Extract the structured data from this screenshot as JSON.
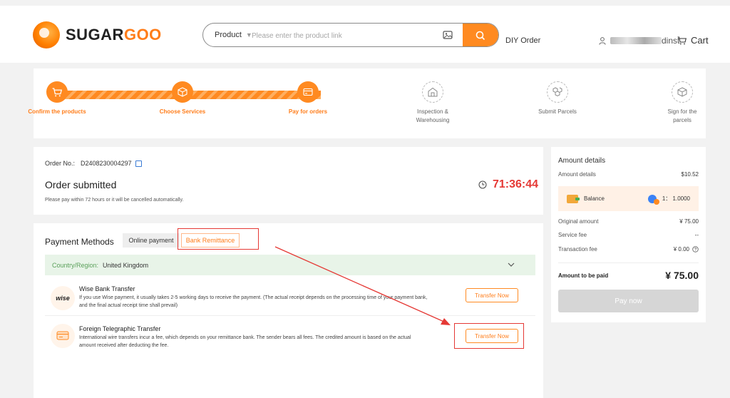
{
  "brand": {
    "name_part1": "SUGAR",
    "name_part2": "GOO"
  },
  "header": {
    "search_type": "Product",
    "search_placeholder": "Please enter the product link",
    "diy_order": "DIY Order",
    "user_suffix": "dinst",
    "cart": "Cart"
  },
  "steps": [
    {
      "label": "Confirm the products",
      "state": "done"
    },
    {
      "label": "Choose Services",
      "state": "done"
    },
    {
      "label": "Pay for orders",
      "state": "current"
    },
    {
      "label": "Inspection & Warehousing",
      "state": "todo"
    },
    {
      "label": "Submit Parcels",
      "state": "todo"
    },
    {
      "label": "Sign for the parcels",
      "state": "todo"
    }
  ],
  "order": {
    "number_label": "Order No.:",
    "number": "D2408230004297",
    "title": "Order submitted",
    "note": "Please pay within 72 hours or it will be cancelled automatically.",
    "countdown": "71:36:44"
  },
  "payment": {
    "title": "Payment Methods",
    "tab_online": "Online payment",
    "tab_bank": "Bank Remittance",
    "region_label": "Country/Region:",
    "region_value": "United Kingdom",
    "methods": [
      {
        "name": "Wise Bank Transfer",
        "icon_text": "wise",
        "desc": "If you use Wise payment, it usually takes 2-5 working days to receive the payment. (The actual receipt depends on the processing time of your payment bank, and the final actual receipt time shall prevail)",
        "button": "Transfer Now"
      },
      {
        "name": "Foreign Telegraphic Transfer",
        "desc": "International wire transfers incur a fee, which depends on your remittance bank. The sender bears all fees. The credited amount is based on the actual amount received after deducting the fee.",
        "button": "Transfer Now"
      }
    ]
  },
  "amount": {
    "title": "Amount details",
    "details_label": "Amount details",
    "details_value": "$10.52",
    "balance_label": "Balance",
    "balance_rate": "1： 1.0000",
    "original_label": "Original amount",
    "original_value": "¥ 75.00",
    "service_label": "Service fee",
    "service_value": "--",
    "transaction_label": "Transaction fee",
    "transaction_value": "¥ 0.00",
    "to_pay_label": "Amount to be paid",
    "to_pay_value": "¥ 75.00",
    "pay_button": "Pay now"
  },
  "colors": {
    "accent": "#ff8a21",
    "highlight": "#e53935",
    "region_bg": "#e8f4e8"
  }
}
